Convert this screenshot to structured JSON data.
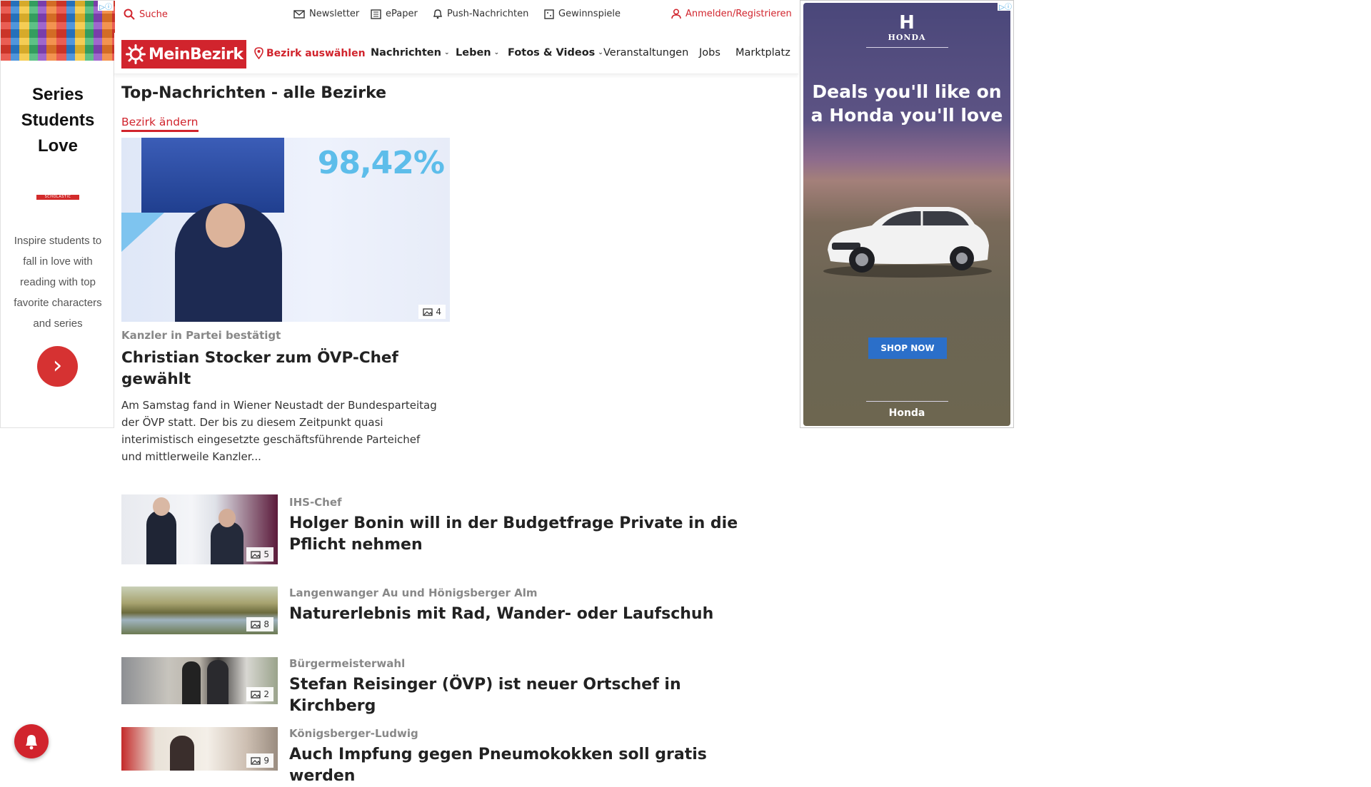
{
  "left_ad": {
    "title": "Series\nStudents\nLove",
    "brand": "SCHOLASTIC",
    "body": "Inspire students to fall in love with reading with top favorite characters and series",
    "cta_icon": "chevron-right-icon"
  },
  "util_bar": {
    "search": "Suche",
    "newsletter": "Newsletter",
    "epaper": "ePaper",
    "push": "Push-Nachrichten",
    "gewinnspiele": "Gewinnspiele",
    "login": "Anmelden/Registrieren"
  },
  "nav": {
    "logo": "MeinBezirk",
    "bezirk": "Bezirk auswählen",
    "items": [
      "Nachrichten",
      "Leben",
      "Fotos & Videos",
      "Veranstaltungen",
      "Jobs",
      "Marktplatz"
    ]
  },
  "page": {
    "title": "Top-Nachrichten - alle Bezirke",
    "change_bezirk": "Bezirk ändern"
  },
  "hero": {
    "image_text": "98,42%",
    "photo_count": "4",
    "kicker": "Kanzler in Partei bestätigt",
    "title": "Christian Stocker zum ÖVP-Chef gewählt",
    "teaser": "Am Samstag fand in Wiener Neustadt der Bundesparteitag der ÖVP statt. Der bis zu diesem Zeitpunkt quasi interimistisch eingesetzte geschäftsführende Parteichef und mittlerweile Kanzler..."
  },
  "articles": [
    {
      "kicker": "IHS-Chef",
      "title": "Holger Bonin will in der Budgetfrage Private in die Pflicht nehmen",
      "photo_count": "5"
    },
    {
      "kicker": "Langenwanger Au und Hönigsberger Alm",
      "title": "Naturerlebnis mit Rad, Wander- oder Laufschuh",
      "photo_count": "8"
    },
    {
      "kicker": "Bürgermeisterwahl",
      "title": "Stefan Reisinger (ÖVP) ist neuer Ortschef in Kirchberg",
      "photo_count": "2"
    },
    {
      "kicker": "Königsberger-Ludwig",
      "title": "Auch Impfung gegen Pneumokokken soll gratis werden",
      "photo_count": "9"
    }
  ],
  "right_ad": {
    "brand_mark": "H",
    "brand": "HONDA",
    "headline": "Deals you'll like on a Honda you'll love",
    "cta": "SHOP NOW",
    "advertiser": "Honda"
  },
  "colors": {
    "brand_red": "#d1242d",
    "honda_blue": "#2b6fc9"
  }
}
